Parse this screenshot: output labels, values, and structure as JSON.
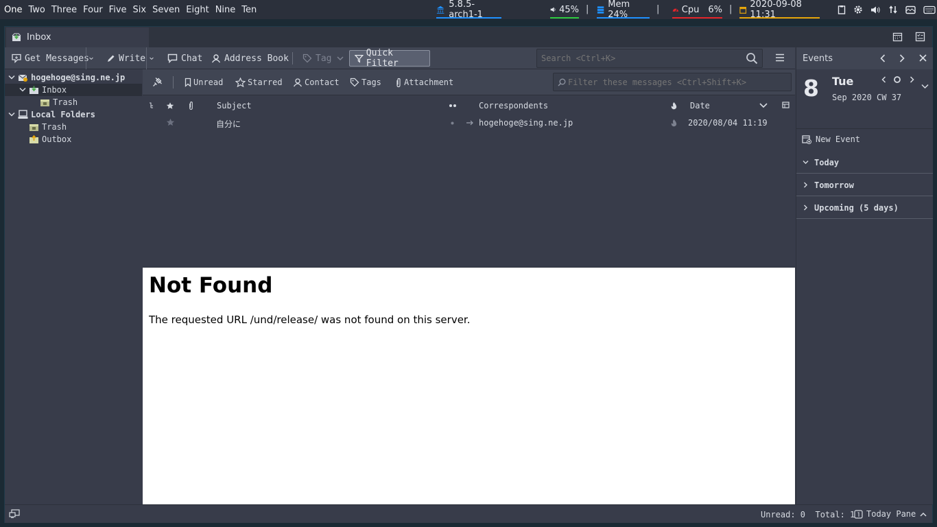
{
  "topbar": {
    "workspaces": [
      "One",
      "Two",
      "Three",
      "Four",
      "Five",
      "Six",
      "Seven",
      "Eight",
      "Nine",
      "Ten"
    ],
    "kernel": "5.8.5-arch1-1",
    "volume": "45%",
    "mem": "Mem 24%",
    "cpu_label": "Cpu",
    "cpu_value": "6%",
    "datetime": "2020-09-08 11:31",
    "separator": "|",
    "colors": {
      "kernel": "#1e90ff",
      "volume": "#2ecc40",
      "mem": "#1e90ff",
      "cpu": "#e5252a",
      "datetime": "#e5a50a"
    }
  },
  "tab": {
    "title": "Inbox"
  },
  "toolbar": {
    "get_messages": "Get Messages",
    "write": "Write",
    "chat": "Chat",
    "address_book": "Address Book",
    "tag": "Tag",
    "quick_filter": "Quick Filter",
    "search_placeholder": "Search <Ctrl+K>"
  },
  "folders": [
    {
      "label": "hogehoge@sing.ne.jp",
      "icon": "account-icon"
    },
    {
      "label": "Inbox",
      "icon": "inbox-folder-icon"
    },
    {
      "label": "Trash",
      "icon": "trash-folder-icon"
    },
    {
      "label": "Local Folders",
      "icon": "local-folders-icon"
    },
    {
      "label": "Trash",
      "icon": "trash-folder-icon"
    },
    {
      "label": "Outbox",
      "icon": "outbox-folder-icon"
    }
  ],
  "quickfilter": {
    "unread": "Unread",
    "starred": "Starred",
    "contact": "Contact",
    "tags": "Tags",
    "attachment": "Attachment",
    "filter_placeholder": "Filter these messages <Ctrl+Shift+K>"
  },
  "thread": {
    "columns": {
      "subject": "Subject",
      "correspondents": "Correspondents",
      "date": "Date"
    },
    "messages": [
      {
        "subject": "自分に",
        "correspondent": "hogehoge@sing.ne.jp",
        "date": "2020/08/04 11:19"
      }
    ]
  },
  "message": {
    "title": "Not Found",
    "body": "The requested URL /und/release/ was not found on this server."
  },
  "today_pane": {
    "header": "Events",
    "day_number": "8",
    "day_name": "Tue",
    "month_week": "Sep 2020 CW 37",
    "new_event": "New Event",
    "sections": [
      "Today",
      "Tomorrow",
      "Upcoming (5 days)"
    ]
  },
  "statusbar": {
    "counts": "Unread: 0  Total: 1",
    "today_pane": "Today Pane"
  }
}
